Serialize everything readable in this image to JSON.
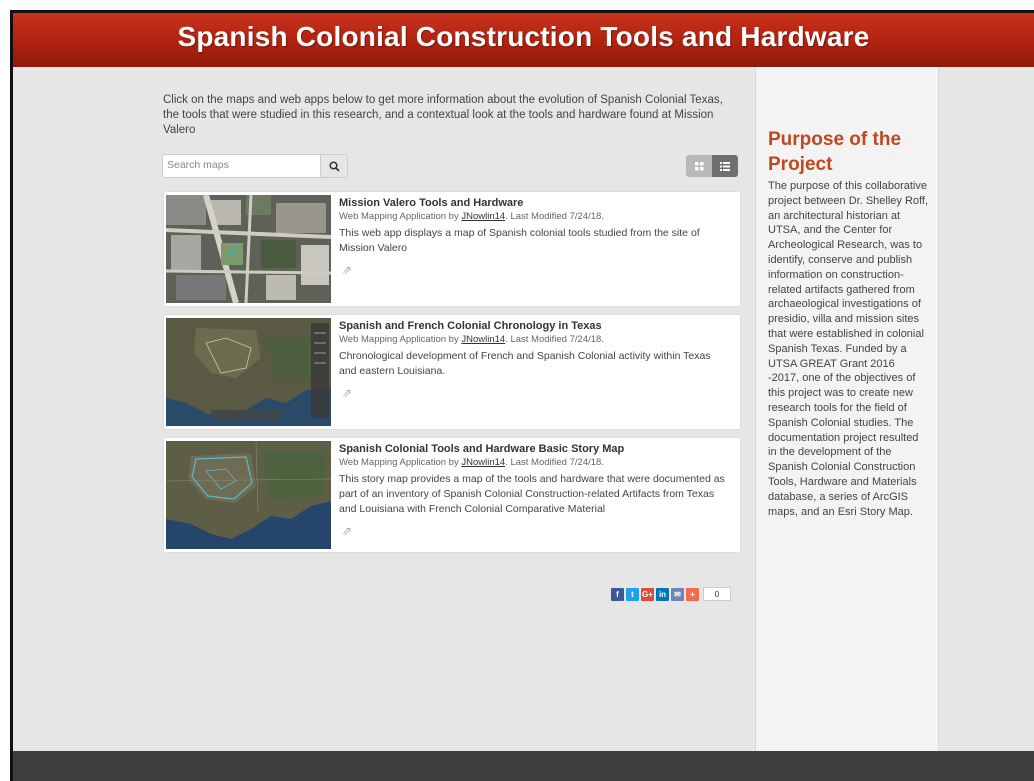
{
  "header": {
    "title": "Spanish Colonial Construction Tools and Hardware"
  },
  "intro": {
    "text": "Click on the maps and web apps below to get more information about the evolution of Spanish Colonial Texas, the tools that were studied in this research, and a contextual look at the tools and hardware found at Mission Valero"
  },
  "search": {
    "placeholder": "Search maps",
    "icon": "search-icon"
  },
  "view_toggle": {
    "grid_icon": "grid-view-icon",
    "list_icon": "list-view-icon",
    "selected": "list"
  },
  "items": [
    {
      "title": "Mission Valero Tools and Hardware",
      "meta_prefix": "Web Mapping Application by ",
      "owner": "JNowlin14",
      "meta_suffix": ". Last Modified 7/24/18.",
      "description": "This web app displays a map of Spanish colonial tools studied from the site of Mission Valero",
      "thumbnail": "aerial-city-map"
    },
    {
      "title": "Spanish and French Colonial Chronology in Texas",
      "meta_prefix": "Web Mapping Application by ",
      "owner": "JNowlin14",
      "meta_suffix": ". Last Modified 7/24/18.",
      "description": "Chronological development of French and Spanish Colonial activity within Texas and eastern Louisiana.",
      "thumbnail": "texas-satellite-map"
    },
    {
      "title": "Spanish Colonial Tools and Hardware Basic Story Map",
      "meta_prefix": "Web Mapping Application by ",
      "owner": "JNowlin14",
      "meta_suffix": ". Last Modified 7/24/18.",
      "description": "This story map provides a map of the tools and hardware that were documented as part of an inventory of Spanish Colonial Construction-related Artifacts from Texas and Louisiana with French Colonial Comparative Material",
      "thumbnail": "texas-satellite-map-2"
    }
  ],
  "share": {
    "buttons": [
      {
        "icon": "facebook-icon",
        "glyph": "f",
        "color": "#3b5998"
      },
      {
        "icon": "twitter-icon",
        "glyph": "t",
        "color": "#1da1f2"
      },
      {
        "icon": "google-plus-icon",
        "glyph": "G+",
        "color": "#dd4b39"
      },
      {
        "icon": "linkedin-icon",
        "glyph": "in",
        "color": "#0077b5"
      },
      {
        "icon": "email-icon",
        "glyph": "✉",
        "color": "#6d84b4"
      },
      {
        "icon": "addthis-icon",
        "glyph": "+",
        "color": "#f8694d"
      }
    ],
    "count": "0"
  },
  "sidebar": {
    "title": "Purpose of the Project",
    "body": "The purpose of this collaborative project between Dr. Shelley Roff, an architectural historian at UTSA, and the Center for Archeological Research, was to identify, conserve and publish information on construction-related artifacts gathered from archaeological investigations of presidio, villa and mission sites that were established in colonial Spanish Texas. Funded by a UTSA GREAT Grant 2016 -2017, one of the objectives of this project was to create new research tools for the field of Spanish Colonial studies. The documentation project resulted in the development of the Spanish Colonial Construction Tools, Hardware and Materials database, a series of ArcGIS maps, and an Esri Story Map."
  },
  "colors": {
    "banner": "#b0220f",
    "sidebar_title": "#c0471f",
    "footer": "#3e3e3e"
  }
}
